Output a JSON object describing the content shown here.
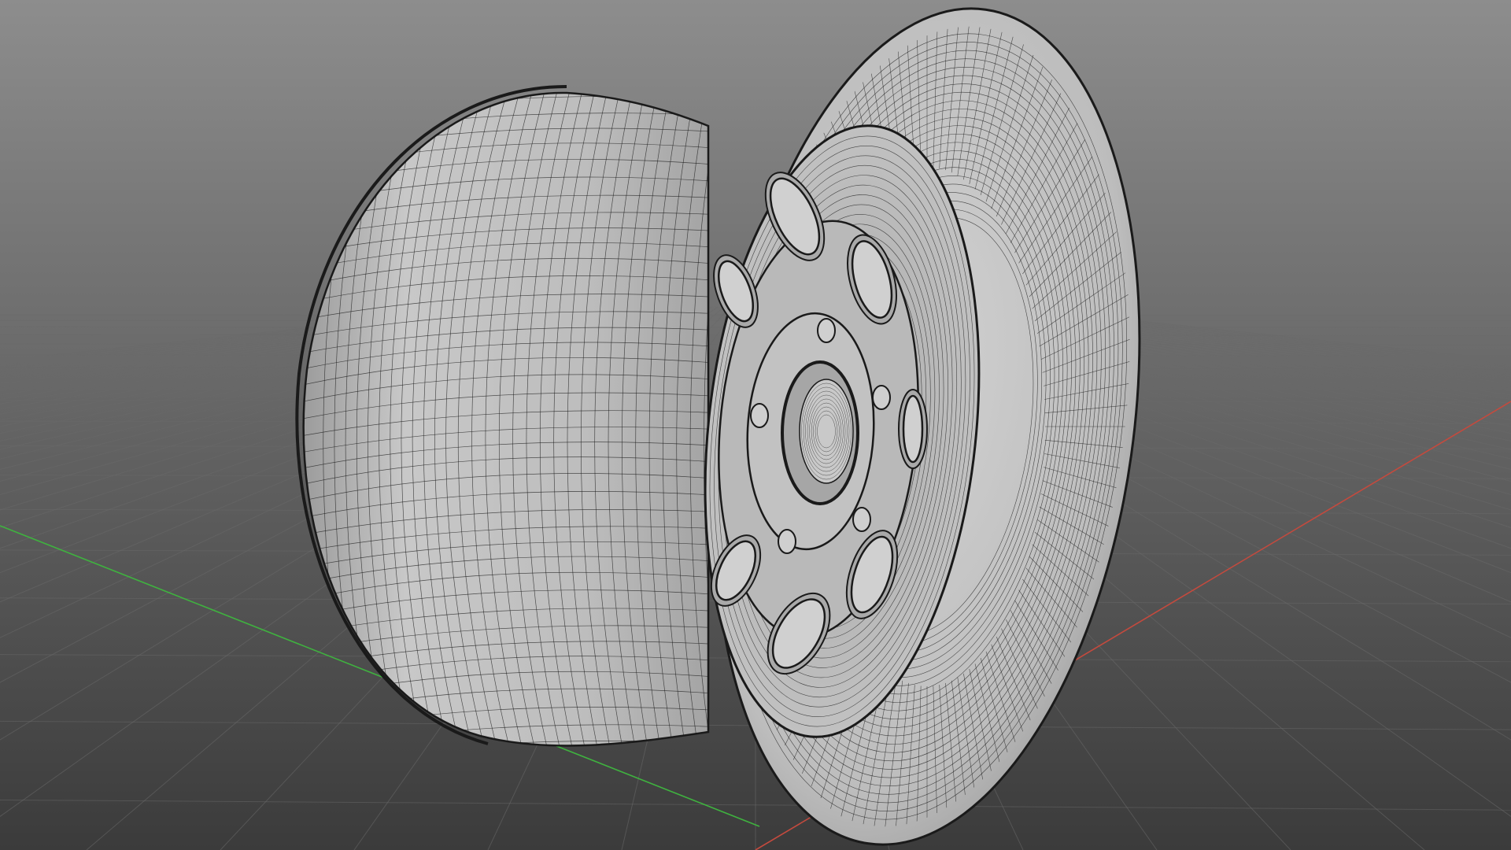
{
  "viewport": {
    "label": "",
    "background": {
      "top": "#8d8d8d",
      "bottom": "#3b3b3b"
    },
    "grid": {
      "visible": true,
      "color": "#6a6a6a"
    },
    "axes": {
      "x_color": "#c44a3e",
      "y_color": "#3fb23f"
    },
    "model": {
      "icon": "wheel-rim-wireframe",
      "surface_color": "#c4c4c4",
      "wire_color": "#1a1a1a"
    }
  }
}
